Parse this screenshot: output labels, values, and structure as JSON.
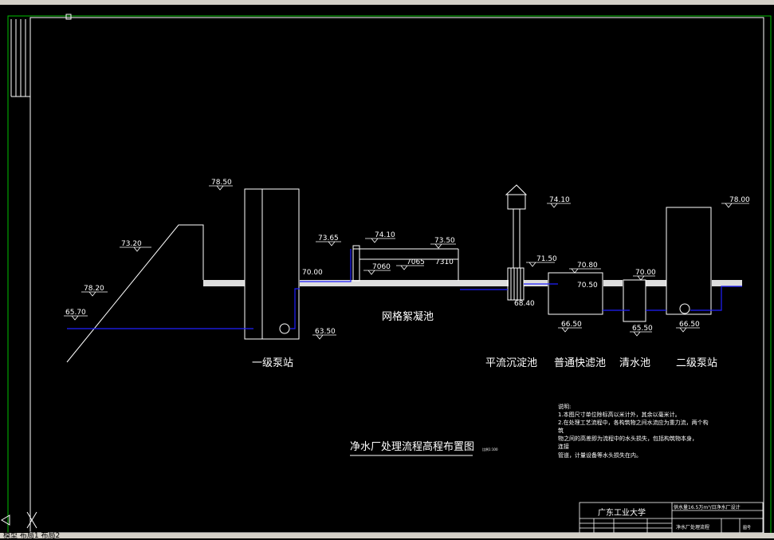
{
  "elevations": {
    "ground_left_top": "78.50",
    "slope_mid": "73.20",
    "slope_low": "78.20",
    "river_level": "65.70",
    "pump1_bottom": "63.50",
    "flocc_in": "73.65",
    "flocc_top": "74.10",
    "flocc_out": "73.50",
    "flocc_a": "7060",
    "flocc_b": "7065",
    "flocc_c": "7310",
    "ground_mid": "70.00",
    "sed_top": "74.10",
    "sed_water": "71.50",
    "sed_bottom": "68.40",
    "filter_top": "70.80",
    "filter_water": "70.50",
    "filter_bottom": "66.50",
    "clear_top": "70.00",
    "clear_bottom": "65.50",
    "pump2_top": "78.00",
    "pump2_bottom": "66.50"
  },
  "labels": {
    "pump1": "一级泵站",
    "flocc": "网格絮凝池",
    "sed": "平流沉淀池",
    "filter": "普通快滤池",
    "clear": "清水池",
    "pump2": "二级泵站"
  },
  "title": "净水厂处理流程高程布置图",
  "scale_note": "比例1:100",
  "notes": {
    "heading": "说明:",
    "line1": "1.本图尺寸单位除标高以米计外，其余以毫米计。",
    "line2": "2.在处理工艺流程中，各构筑物之间水流应为重力流，两个构",
    "line2b": "筑",
    "line3": "    物之间的高差即为流程中的水头损失，包括构筑物本身，",
    "line3b": "连接",
    "line4": "    管道，计量设备等水头损失在内。"
  },
  "title_block": {
    "school": "广东工业大学",
    "project": "供水量16.5万m³/日净水厂设计",
    "drawing": "净水厂处理流程",
    "sheet": "图号"
  },
  "status_bar": "模型 布局1 布局2"
}
